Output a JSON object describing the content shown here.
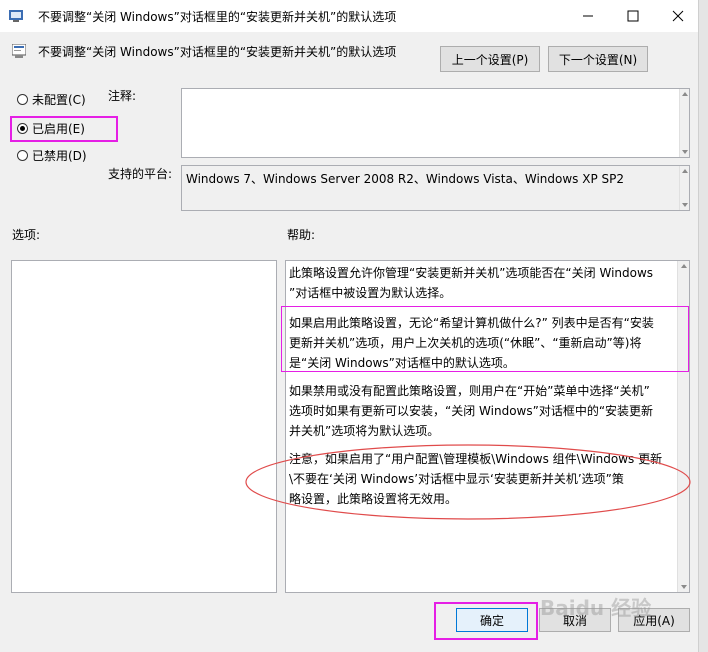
{
  "window": {
    "title": "不要调整“关闭 Windows”对话框里的“安装更新并关机”的默认选项",
    "minimize_icon": "minimize-icon",
    "maximize_icon": "maximize-icon",
    "close_icon": "close-icon"
  },
  "header": {
    "setting_name": "不要调整“关闭 Windows”对话框里的“安装更新并关机”的默认选项",
    "prev_button": "上一个设置(P)",
    "next_button": "下一个设置(N)"
  },
  "state": {
    "options": [
      {
        "label": "未配置(C)",
        "selected": false
      },
      {
        "label": "已启用(E)",
        "selected": true
      },
      {
        "label": "已禁用(D)",
        "selected": false
      }
    ]
  },
  "comment": {
    "label": "注释:",
    "value": ""
  },
  "platform": {
    "label": "支持的平台:",
    "value": "Windows 7、Windows Server 2008 R2、Windows Vista、Windows XP SP2"
  },
  "sections": {
    "options_label": "选项:",
    "help_label": "帮助:"
  },
  "help": {
    "p1_l1": "此策略设置允许你管理“安装更新并关机”选项能否在“关闭 Windows",
    "p1_l2": "”对话框中被设置为默认选择。",
    "p2_l1": "如果启用此策略设置，无论“希望计算机做什么?” 列表中是否有“安装",
    "p2_l2": "更新并关机”选项，用户上次关机的选项(“休眠”、“重新启动”等)将",
    "p2_l3": "是“关闭 Windows”对话框中的默认选项。",
    "p3_l1": "如果禁用或没有配置此策略设置，则用户在“开始”菜单中选择“关机”",
    "p3_l2": "选项时如果有更新可以安装，“关闭 Windows”对话框中的“安装更新",
    "p3_l3": "并关机”选项将为默认选项。",
    "p4_l1": "注意，如果启用了“用户配置\\管理模板\\Windows 组件\\Windows 更新",
    "p4_l2": "\\不要在‘关闭 Windows’对话框中显示‘安装更新并关机’选项”策",
    "p4_l3": "略设置，此策略设置将无效用。"
  },
  "footer": {
    "ok": "确定",
    "cancel": "取消",
    "apply": "应用(A)"
  },
  "watermark": "Baidu 经验",
  "colors": {
    "highlight_magenta": "#e51fe5",
    "annotation_red": "#e04b4b",
    "focus_blue": "#0078d7"
  }
}
